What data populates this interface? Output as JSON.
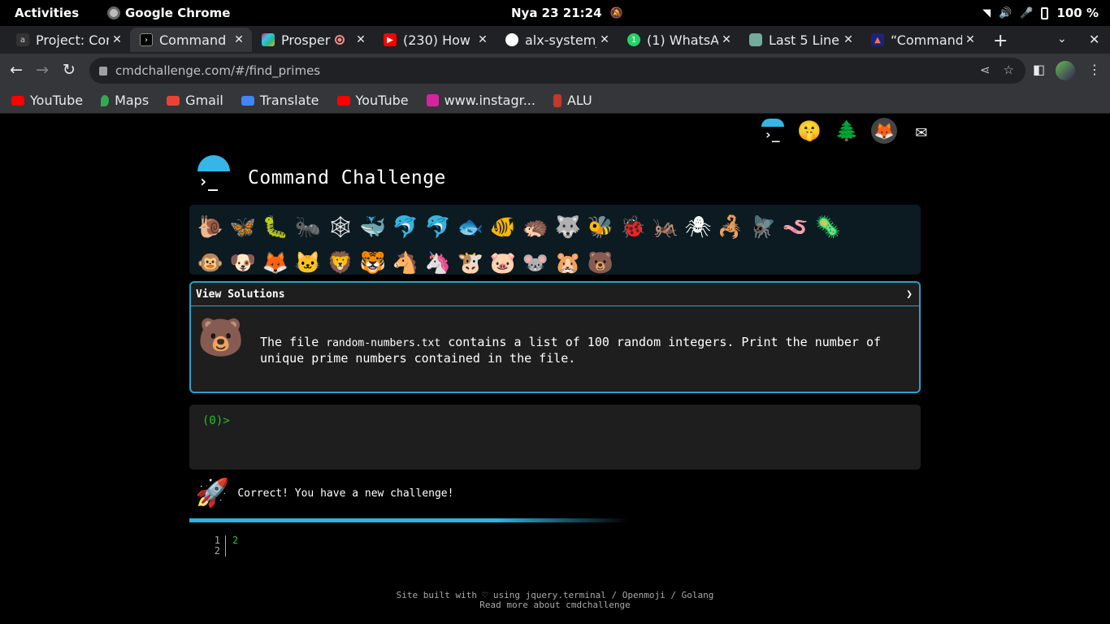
{
  "system_bar": {
    "activities": "Activities",
    "app_name": "Google Chrome",
    "clock": "Nya 23  21:24",
    "battery": "100 %"
  },
  "tabs": [
    {
      "title": "Project: Cor",
      "active": false
    },
    {
      "title": "Command",
      "active": true
    },
    {
      "title": "Prosper",
      "active": false
    },
    {
      "title": "(230) How",
      "active": false
    },
    {
      "title": "alx-system_",
      "active": false
    },
    {
      "title": "(1) WhatsA",
      "active": false
    },
    {
      "title": "Last 5 Line",
      "active": false
    },
    {
      "title": "“Command",
      "active": false
    }
  ],
  "address_bar": {
    "url": "cmdchallenge.com/#/find_primes"
  },
  "bookmarks": [
    {
      "label": "YouTube",
      "icon": "youtube-icon",
      "color": "#ff0000"
    },
    {
      "label": "Maps",
      "icon": "maps-icon",
      "color": "#34a853"
    },
    {
      "label": "Gmail",
      "icon": "gmail-icon",
      "color": "#ea4335"
    },
    {
      "label": "Translate",
      "icon": "translate-icon",
      "color": "#4285f4"
    },
    {
      "label": "YouTube",
      "icon": "youtube-icon",
      "color": "#ff0000"
    },
    {
      "label": "www.instagr...",
      "icon": "instagram-icon",
      "color": "#d6249f"
    },
    {
      "label": "ALU",
      "icon": "alu-icon",
      "color": "#c0392b"
    }
  ],
  "page": {
    "title": "Command Challenge",
    "top_icons": [
      "terminal-icon",
      "shush-face-icon",
      "tree-icon",
      "gitlab-icon",
      "mail-icon"
    ],
    "challenge_emojis_row1": [
      "🐌",
      "🦋",
      "🐛",
      "🐜",
      "🕸",
      "🐳",
      "🐬",
      "🐬",
      "🐟",
      "🐠",
      "🦔",
      "🐺",
      "🐝",
      "🐞",
      "🦗",
      "🕷",
      "🦂",
      "🪰",
      "🪱",
      "🦠",
      "🐵",
      "🐶"
    ],
    "challenge_emojis_row2": [
      "🦊",
      "🐱",
      "🦁",
      "🐯",
      "🐴",
      "🦄",
      "🐮",
      "🐷",
      "🐭",
      "🐹",
      "🐻"
    ],
    "view_solutions": "View Solutions",
    "view_solutions_arrow": "❯",
    "challenge_text_before": "The file ",
    "challenge_file": "random-numbers.txt",
    "challenge_text_after": " contains a list of 100 random integers. Print the number of unique prime numbers contained in the file.",
    "prompt": "(0)>",
    "result_message": "Correct! You have a new challenge!",
    "output_line_numbers": [
      "1",
      "2"
    ],
    "output_lines": [
      "2",
      ""
    ],
    "footer_line1": "Site built with ♡ using jquery.terminal / Openmoji / Golang",
    "footer_line2": "Read more about cmdchallenge"
  },
  "colors": {
    "accent": "#2aa0c8",
    "prompt_green": "#25c12a"
  }
}
